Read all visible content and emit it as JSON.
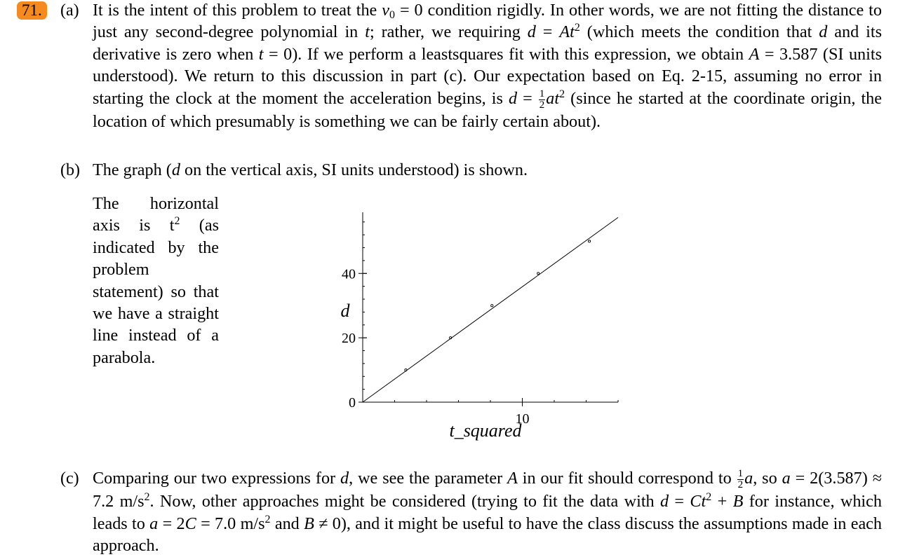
{
  "problem_number": "71.",
  "part_a": {
    "label": "(a)",
    "s1": "It is the intent of this problem to treat the ",
    "v": "v",
    "v_sub": "0",
    "s2": " = 0 condition rigidly. In other words, we are not fitting the distance to just any second-degree polynomial in ",
    "t1": "t",
    "s3": "; rather, we requiring ",
    "d1": "d",
    "s4": " = ",
    "A1": "At",
    "sq1": "2",
    "s5": " (which meets the condition that ",
    "d2": "d",
    "s6": " and its derivative is zero when ",
    "t2": "t",
    "s7": " = 0). If we perform a leastsquares fit with this expression, we obtain ",
    "A2": "A",
    "s8": " = 3.587 (SI units understood). We return to this discussion in part (c). Our expectation based on Eq. 2-15, assuming no error in starting the clock at the moment the acceleration begins, is ",
    "d3": "d",
    "s9": " = ",
    "frac_num": "1",
    "frac_den": "2",
    "at": "at",
    "sq2": "2",
    "s10": " (since he started at the coordinate origin, the location of which presumably is something we can be fairly certain about)."
  },
  "part_b": {
    "label": "(b)",
    "s1": "The graph (",
    "d": "d",
    "s2": " on the vertical axis, SI units understood) is shown.",
    "side_1": "The horizontal axis is ",
    "side_t": "t",
    "side_sq": "2",
    "side_2": " (as indicated by the problem statement) so that we have a straight line instead of a parabola."
  },
  "part_c": {
    "label": "(c)",
    "s1": "Comparing our two expressions for ",
    "d1": "d",
    "s2": ", we see the parameter ",
    "A1": "A",
    "s3": " in our fit should correspond to ",
    "frac_num": "1",
    "frac_den": "2",
    "a1": "a",
    "s4": ", so ",
    "a2": "a",
    "s5": " = 2(3.587) ≈ 7.2 m/s",
    "sq1": "2",
    "s6": ". Now, other approaches might be considered (trying to fit the data with ",
    "d2": "d",
    "s7": " = ",
    "Ct": "Ct",
    "sq2": "2",
    "s8": " + ",
    "B1": "B",
    "s9": " for instance, which leads to ",
    "a3": "a",
    "s10": " = 2",
    "C": "C",
    "s11": " = 7.0 m/s",
    "sq3": "2",
    "s12": " and ",
    "B2": "B",
    "s13": " ≠ 0), and it might be useful to have the class discuss the assumptions made in each approach."
  },
  "chart_data": {
    "type": "scatter",
    "xlabel": "t_squared",
    "ylabel": "d",
    "xlim": [
      0,
      16
    ],
    "ylim": [
      0,
      59
    ],
    "x_ticks": [
      10
    ],
    "y_ticks": [
      0,
      20,
      40
    ],
    "points": [
      {
        "x": 2.7,
        "y": 10.0
      },
      {
        "x": 5.5,
        "y": 20.0
      },
      {
        "x": 8.1,
        "y": 30.0
      },
      {
        "x": 11.0,
        "y": 40.0
      },
      {
        "x": 14.2,
        "y": 50.0
      }
    ],
    "fit_line": {
      "slope": 3.587,
      "intercept": 0
    },
    "grid": false
  }
}
